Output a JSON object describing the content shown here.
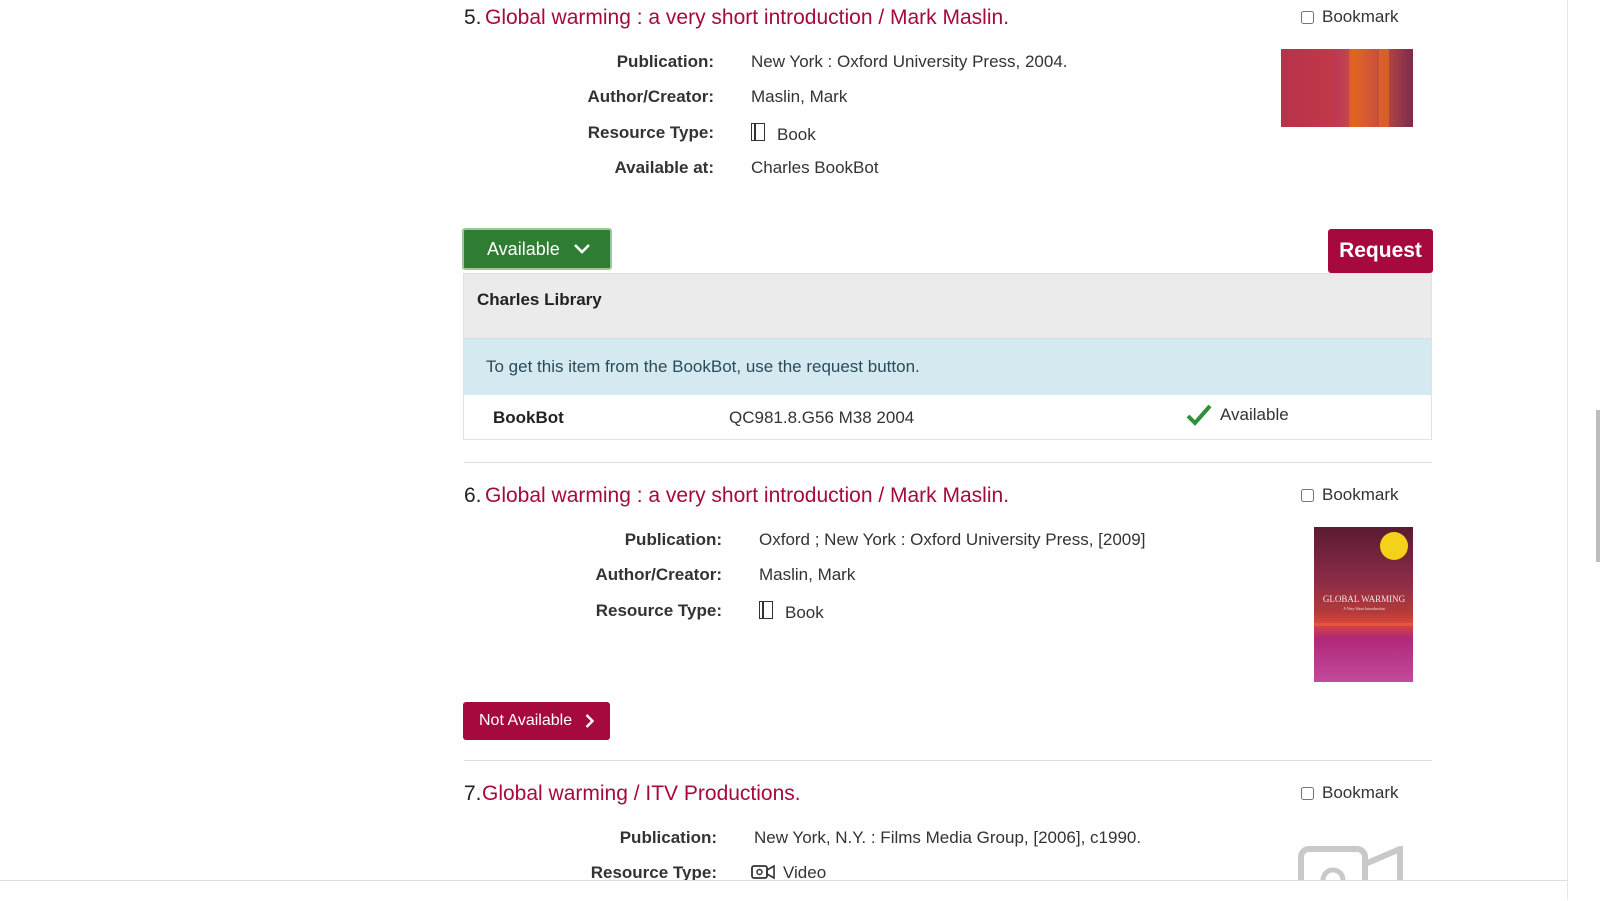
{
  "results": [
    {
      "number": "5.",
      "title": "Global warming : a very short introduction / Mark Maslin.",
      "bookmark_label": "Bookmark",
      "fields": {
        "publication_label": "Publication:",
        "publication": "New York : Oxford University Press, 2004.",
        "author_label": "Author/Creator:",
        "author": "Maslin, Mark",
        "type_label": "Resource Type:",
        "type": "Book",
        "available_label": "Available at:",
        "available_at": "Charles BookBot"
      },
      "status_button": "Available",
      "request_button": "Request",
      "holdings": {
        "location": "Charles Library",
        "notice": "To get this item from the BookBot, use the request button.",
        "row": {
          "location": "BookBot",
          "call_number": "QC981.8.G56 M38 2004",
          "status": "Available"
        }
      },
      "cover_colors": [
        "#b7324a",
        "#e1651f",
        "#7c2b4e"
      ]
    },
    {
      "number": "6.",
      "title": "Global warming : a very short introduction / Mark Maslin.",
      "bookmark_label": "Bookmark",
      "fields": {
        "publication_label": "Publication:",
        "publication": "Oxford ; New York : Oxford University Press, [2009]",
        "author_label": "Author/Creator:",
        "author": "Maslin, Mark",
        "type_label": "Resource Type:",
        "type": "Book"
      },
      "status_button": "Not Available",
      "cover_text": "GLOBAL WARMING",
      "cover_subtext": "A Very Short Introduction"
    },
    {
      "number": "7.",
      "title": "Global warming / ITV Productions.",
      "bookmark_label": "Bookmark",
      "fields": {
        "publication_label": "Publication:",
        "publication": "New York, N.Y. : Films Media Group, [2006], c1990.",
        "type_label": "Resource Type:",
        "type": "Video"
      }
    }
  ],
  "colors": {
    "brand": "#a6093d",
    "available": "#2f7d32",
    "notice_bg": "#d5eaf0"
  }
}
